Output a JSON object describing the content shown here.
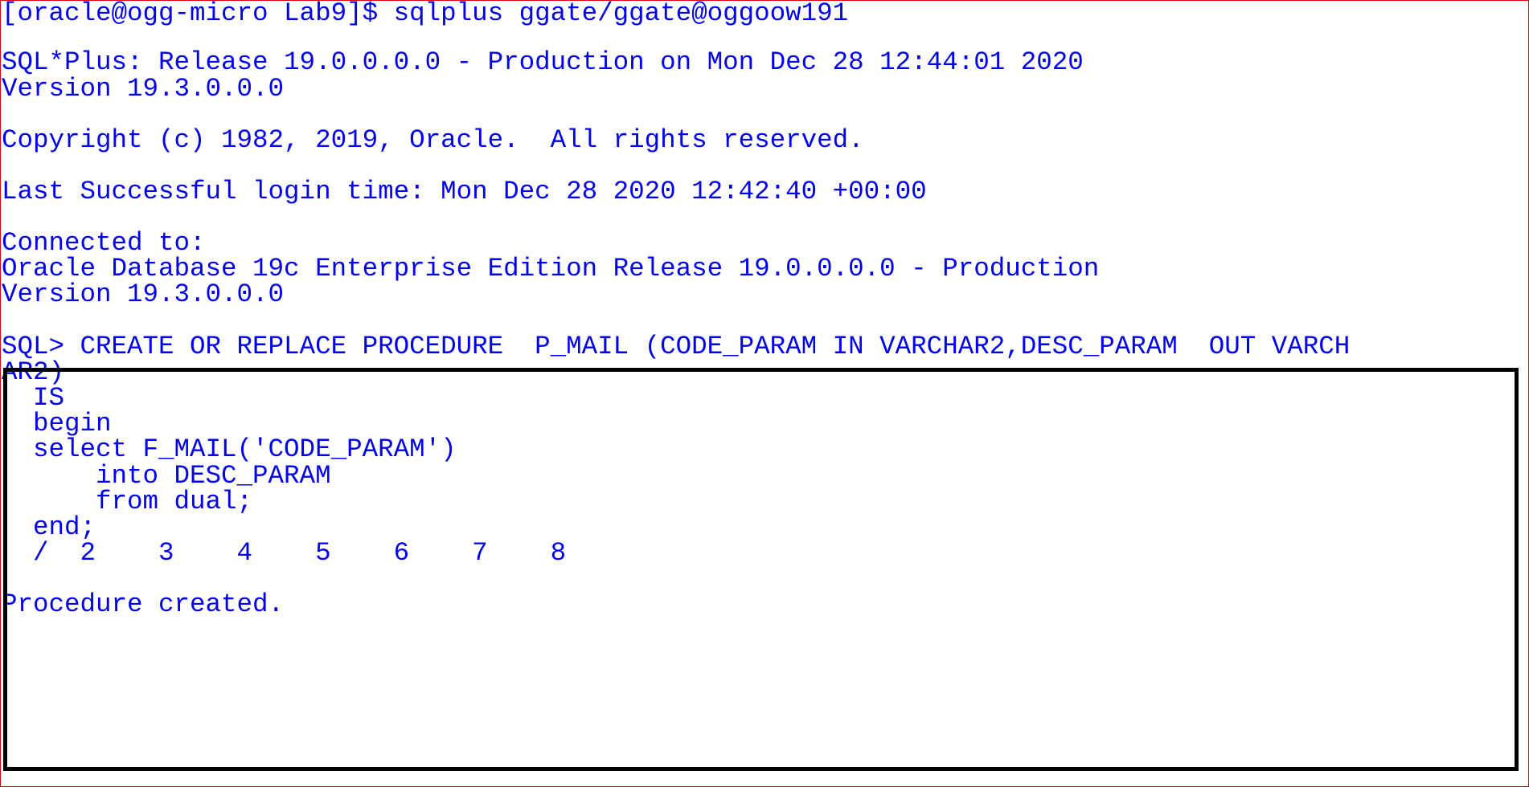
{
  "colors": {
    "text": "#0000ee",
    "frame_border": "#e0000a",
    "highlight_border": "#000000",
    "background": "#ffffff"
  },
  "terminal": {
    "lines": [
      "[oracle@ogg-micro Lab9]$ sqlplus ggate/ggate@oggoow191",
      "",
      "SQL*Plus: Release 19.0.0.0.0 - Production on Mon Dec 28 12:44:01 2020",
      "Version 19.3.0.0.0",
      "",
      "Copyright (c) 1982, 2019, Oracle.  All rights reserved.",
      "",
      "Last Successful login time: Mon Dec 28 2020 12:42:40 +00:00",
      "",
      "Connected to:",
      "Oracle Database 19c Enterprise Edition Release 19.0.0.0.0 - Production",
      "Version 19.3.0.0.0",
      "",
      "SQL> CREATE OR REPLACE PROCEDURE  P_MAIL (CODE_PARAM IN VARCHAR2,DESC_PARAM  OUT VARCH",
      "AR2)",
      "  IS",
      "  begin",
      "  select F_MAIL('CODE_PARAM')",
      "      into DESC_PARAM",
      "      from dual;",
      "  end;",
      "  /  2    3    4    5    6    7    8",
      "",
      "Procedure created."
    ]
  }
}
